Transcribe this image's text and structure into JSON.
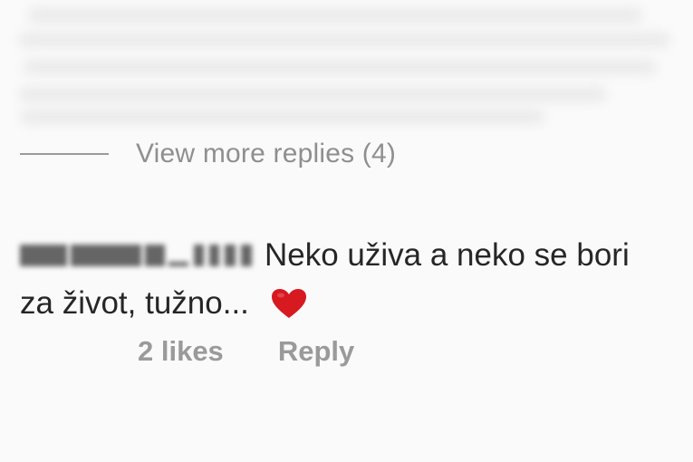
{
  "view_more": {
    "label": "View more replies (4)"
  },
  "comment": {
    "text_line1": "Neko uživa a neko se bori",
    "text_line2": "za život, tužno...",
    "emoji": "heart-icon",
    "heart_color": "#d71920"
  },
  "actions": {
    "likes": "2 likes",
    "reply": "Reply"
  }
}
